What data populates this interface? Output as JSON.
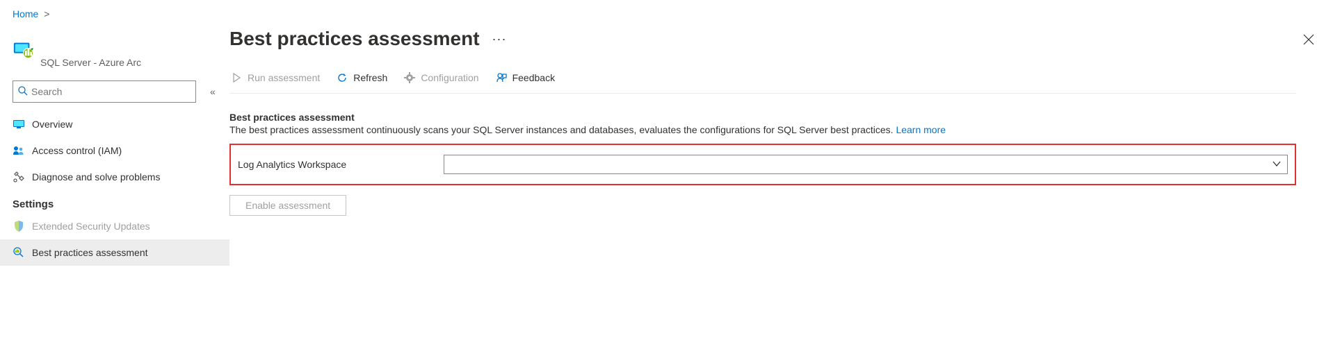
{
  "breadcrumb": {
    "home": "Home"
  },
  "resource": {
    "type": "SQL Server - Azure Arc"
  },
  "search": {
    "placeholder": "Search"
  },
  "nav": {
    "overview": "Overview",
    "access_control": "Access control (IAM)",
    "diagnose": "Diagnose and solve problems",
    "settings_label": "Settings",
    "extended_security": "Extended Security Updates",
    "best_practices": "Best practices assessment"
  },
  "page": {
    "title": "Best practices assessment"
  },
  "toolbar": {
    "run": "Run assessment",
    "refresh": "Refresh",
    "configuration": "Configuration",
    "feedback": "Feedback"
  },
  "section": {
    "heading": "Best practices assessment",
    "description": "The best practices assessment continuously scans your SQL Server instances and databases, evaluates the configurations for SQL Server best practices. ",
    "learn_more": "Learn more",
    "field_label": "Log Analytics Workspace",
    "enable_button": "Enable assessment"
  }
}
